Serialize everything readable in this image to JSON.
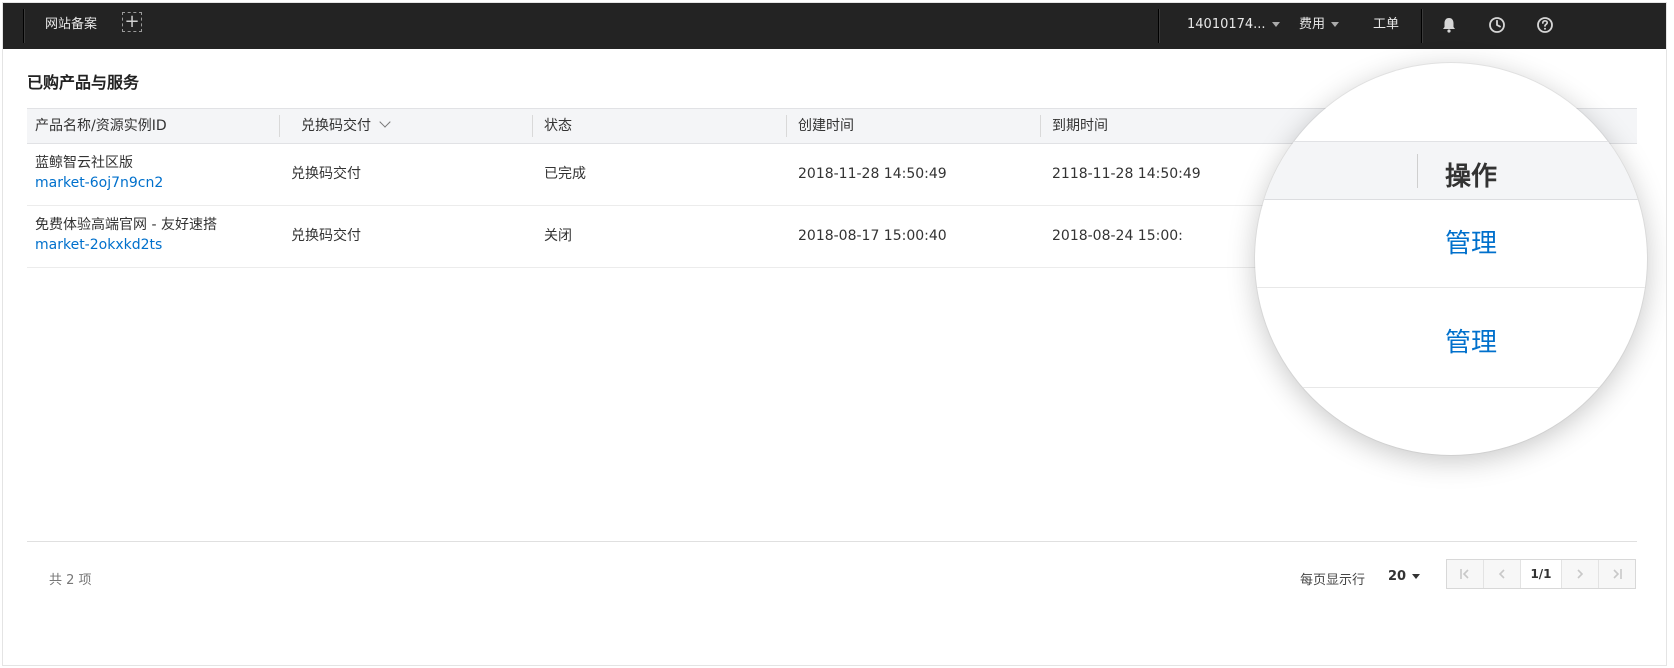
{
  "topbar": {
    "site_filing": "网站备案",
    "add_icon": "+",
    "account": "14010174...",
    "billing": "费用",
    "ticket": "工单"
  },
  "page": {
    "title": "已购产品与服务"
  },
  "table": {
    "headers": {
      "name": "产品名称/资源实例ID",
      "delivery": "兑换码交付",
      "status": "状态",
      "created": "创建时间",
      "expires": "到期时间"
    },
    "rows": [
      {
        "name": "蓝鲸智云社区版",
        "instance_id": "market-6oj7n9cn2",
        "delivery": "兑换码交付",
        "status": "已完成",
        "created": "2018-11-28 14:50:49",
        "expires": "2118-11-28 14:50:49"
      },
      {
        "name": "免费体验高端官网 - 友好速搭",
        "instance_id": "market-2okxkd2ts",
        "delivery": "兑换码交付",
        "status": "关闭",
        "created": "2018-08-17 15:00:40",
        "expires": "2018-08-24 15:00:"
      }
    ]
  },
  "magnifier": {
    "header": "操作",
    "actions": [
      "管理",
      "管理"
    ]
  },
  "pagination": {
    "total": "共 2 项",
    "per_page_label": "每页显示行",
    "per_page_value": "20",
    "current": "1/1"
  }
}
